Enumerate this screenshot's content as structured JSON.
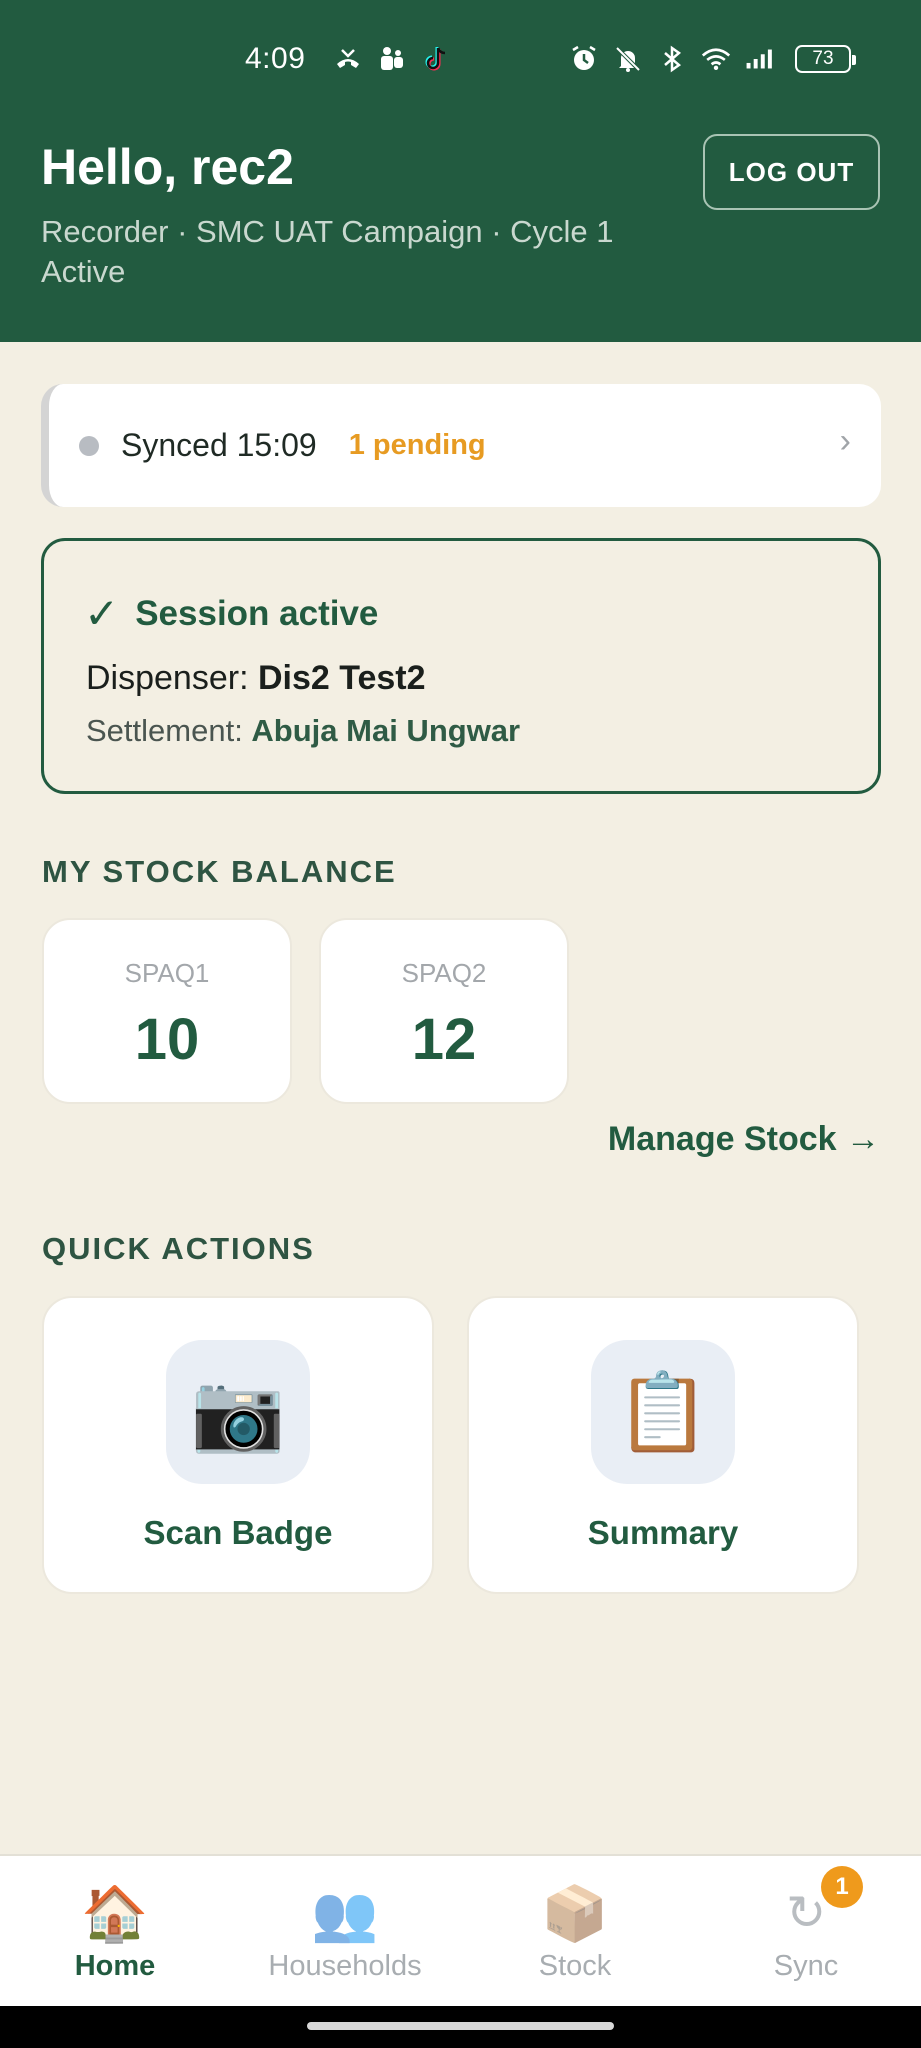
{
  "status_bar": {
    "time": "4:09",
    "battery": "73",
    "left_icons": [
      "missed-call-icon",
      "teams-icon",
      "tiktok-icon"
    ],
    "right_icons": [
      "alarm-icon",
      "mute-icon",
      "bluetooth-icon",
      "wifi-icon",
      "signal-icon"
    ]
  },
  "header": {
    "greeting": "Hello, rec2",
    "subtitle": "Recorder · SMC UAT Campaign · Cycle 1 Active",
    "logout_label": "LOG OUT"
  },
  "sync": {
    "status": "Synced 15:09",
    "pending": "1 pending",
    "chevron": "›"
  },
  "session": {
    "check": "✓",
    "title": "Session active",
    "dispenser_label": "Dispenser: ",
    "dispenser_name": "Dis2 Test2",
    "settlement_label": "Settlement: ",
    "settlement_name": "Abuja Mai Ungwar"
  },
  "stock": {
    "heading": "MY STOCK BALANCE",
    "items": [
      {
        "name": "SPAQ1",
        "value": "10"
      },
      {
        "name": "SPAQ2",
        "value": "12"
      }
    ],
    "manage_label": "Manage Stock →"
  },
  "quick_actions": {
    "heading": "QUICK ACTIONS",
    "items": [
      {
        "label": "Scan Badge",
        "icon": "📷"
      },
      {
        "label": "Summary",
        "icon": "📋"
      }
    ]
  },
  "nav": {
    "items": [
      {
        "label": "Home",
        "icon": "🏠"
      },
      {
        "label": "Households",
        "icon": "👥"
      },
      {
        "label": "Stock",
        "icon": "📦"
      },
      {
        "label": "Sync",
        "icon": "↻",
        "badge": "1"
      }
    ]
  },
  "colors": {
    "primary": "#225b40",
    "background": "#f3efe3",
    "pending": "#e79b22",
    "badge": "#ef9a1c"
  }
}
